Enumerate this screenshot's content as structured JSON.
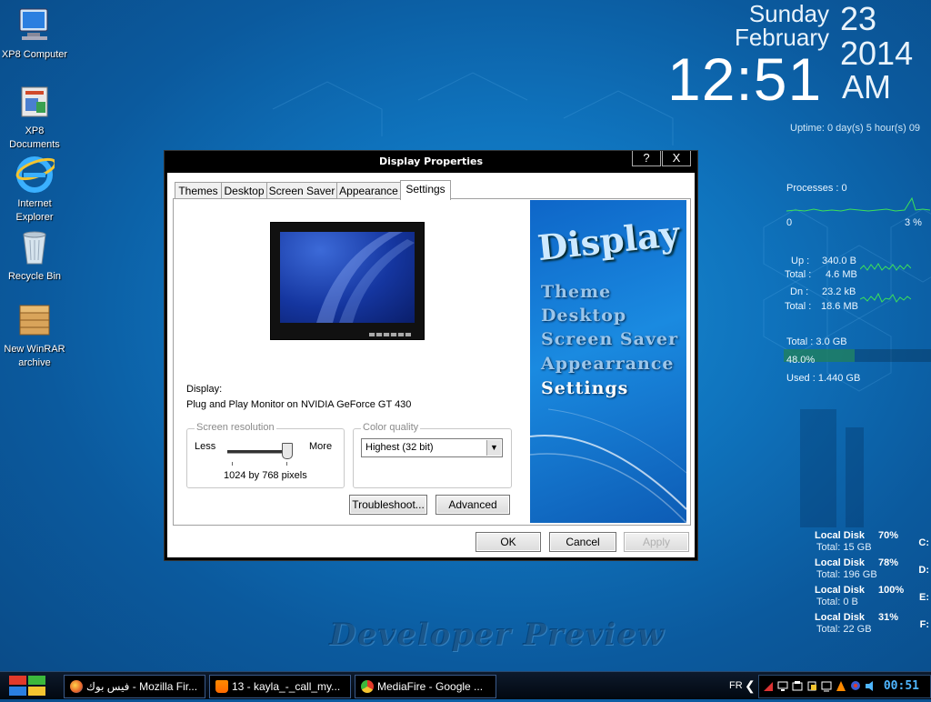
{
  "desktop": {
    "icons": [
      {
        "label": "XP8 Computer"
      },
      {
        "label": "XP8 Documents"
      },
      {
        "label": "Internet Explorer"
      },
      {
        "label": "Recycle Bin"
      },
      {
        "label": "New WinRAR archive"
      }
    ],
    "watermark": "Developer Preview"
  },
  "clock": {
    "weekday": "Sunday",
    "month": "February",
    "day": "23",
    "year": "2014",
    "time": "12:51",
    "ampm": "AM",
    "uptime": "Uptime: 0 day(s)  5 hour(s)  09"
  },
  "meters": {
    "processes": "Processes : 0",
    "cpu_min": "0",
    "cpu_max": "3 %",
    "up_label": "Up :",
    "up_value": "340.0 B",
    "up_total_label": "Total :",
    "up_total": "4.6 MB",
    "dn_label": "Dn :",
    "dn_value": "23.2 kB",
    "dn_total_label": "Total :",
    "dn_total": "18.6 MB",
    "mem_total": "Total : 3.0 GB",
    "mem_percent": "48.0%",
    "mem_used": "Used : 1.440 GB",
    "mem_fraction": 0.48
  },
  "disks": [
    {
      "label": "Local Disk",
      "percent": "70%",
      "total": "Total: 15 GB",
      "drive": "C:"
    },
    {
      "label": "Local Disk",
      "percent": "78%",
      "total": "Total: 196 GB",
      "drive": "D:"
    },
    {
      "label": "Local Disk",
      "percent": "100%",
      "total": "Total: 0 B",
      "drive": "E:"
    },
    {
      "label": "Local Disk",
      "percent": "31%",
      "total": "Total: 22 GB",
      "drive": "F:"
    }
  ],
  "dialog": {
    "title": "Display Properties",
    "help_button": "?",
    "close_button": "X",
    "tabs": [
      "Themes",
      "Desktop",
      "Screen Saver",
      "Appearance",
      "Settings"
    ],
    "active_tab": "Settings",
    "display_label": "Display:",
    "display_value": "Plug and Play Monitor on NVIDIA GeForce GT 430",
    "resolution": {
      "group_title": "Screen resolution",
      "less": "Less",
      "more": "More",
      "value": "1024 by 768 pixels"
    },
    "color": {
      "group_title": "Color quality",
      "selected": "Highest (32 bit)"
    },
    "troubleshoot": "Troubleshoot...",
    "advanced": "Advanced",
    "ok": "OK",
    "cancel": "Cancel",
    "apply": "Apply",
    "side_banner": {
      "title": "Display",
      "items": [
        "Theme",
        "Desktop",
        "Screen Saver",
        "Appearrance",
        "Settings"
      ]
    }
  },
  "taskbar": {
    "buttons": [
      {
        "label": "فيس بوك - Mozilla Fir..."
      },
      {
        "label": "13 - kayla_-_call_my..."
      },
      {
        "label": "MediaFire - Google ..."
      }
    ],
    "language": "FR",
    "time": "00:51"
  }
}
